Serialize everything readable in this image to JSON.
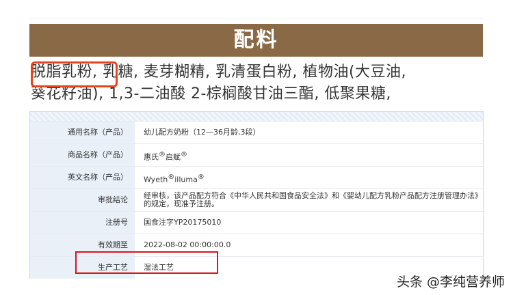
{
  "ingredients": {
    "title": "配料",
    "line1": "脱脂乳粉, 乳糖, 麦芽糊精, 乳清蛋白粉, 植物油(大豆油,",
    "line2": "葵花籽油), 1,3-二油酸 2-棕榈酸甘油三酯, 低聚果糖,"
  },
  "rows": [
    {
      "label": "通用名称（产品）",
      "value": "幼儿配方奶粉（12—36月龄,3段）"
    },
    {
      "label": "商品名称（产品）",
      "value_a": "惠氏",
      "value_b": "启赋",
      "reg": "®"
    },
    {
      "label": "英文名称（产品）",
      "value_a": "Wyeth",
      "value_b": "illuma",
      "reg": "®"
    },
    {
      "label": "审批结论",
      "value": "经审核，该产品配方符合《中华人民共和国食品安全法》和《婴幼儿配方乳粉产品配方注册管理办法》的规定，现准予注册。"
    },
    {
      "label": "注册号",
      "value": "国食注字YP20175010"
    },
    {
      "label": "有效期至",
      "value": "2022-08-02 00:00:00.0"
    },
    {
      "label": "生产工艺",
      "value": "湿法工艺"
    }
  ],
  "watermark": "头条 @李纯营养师"
}
